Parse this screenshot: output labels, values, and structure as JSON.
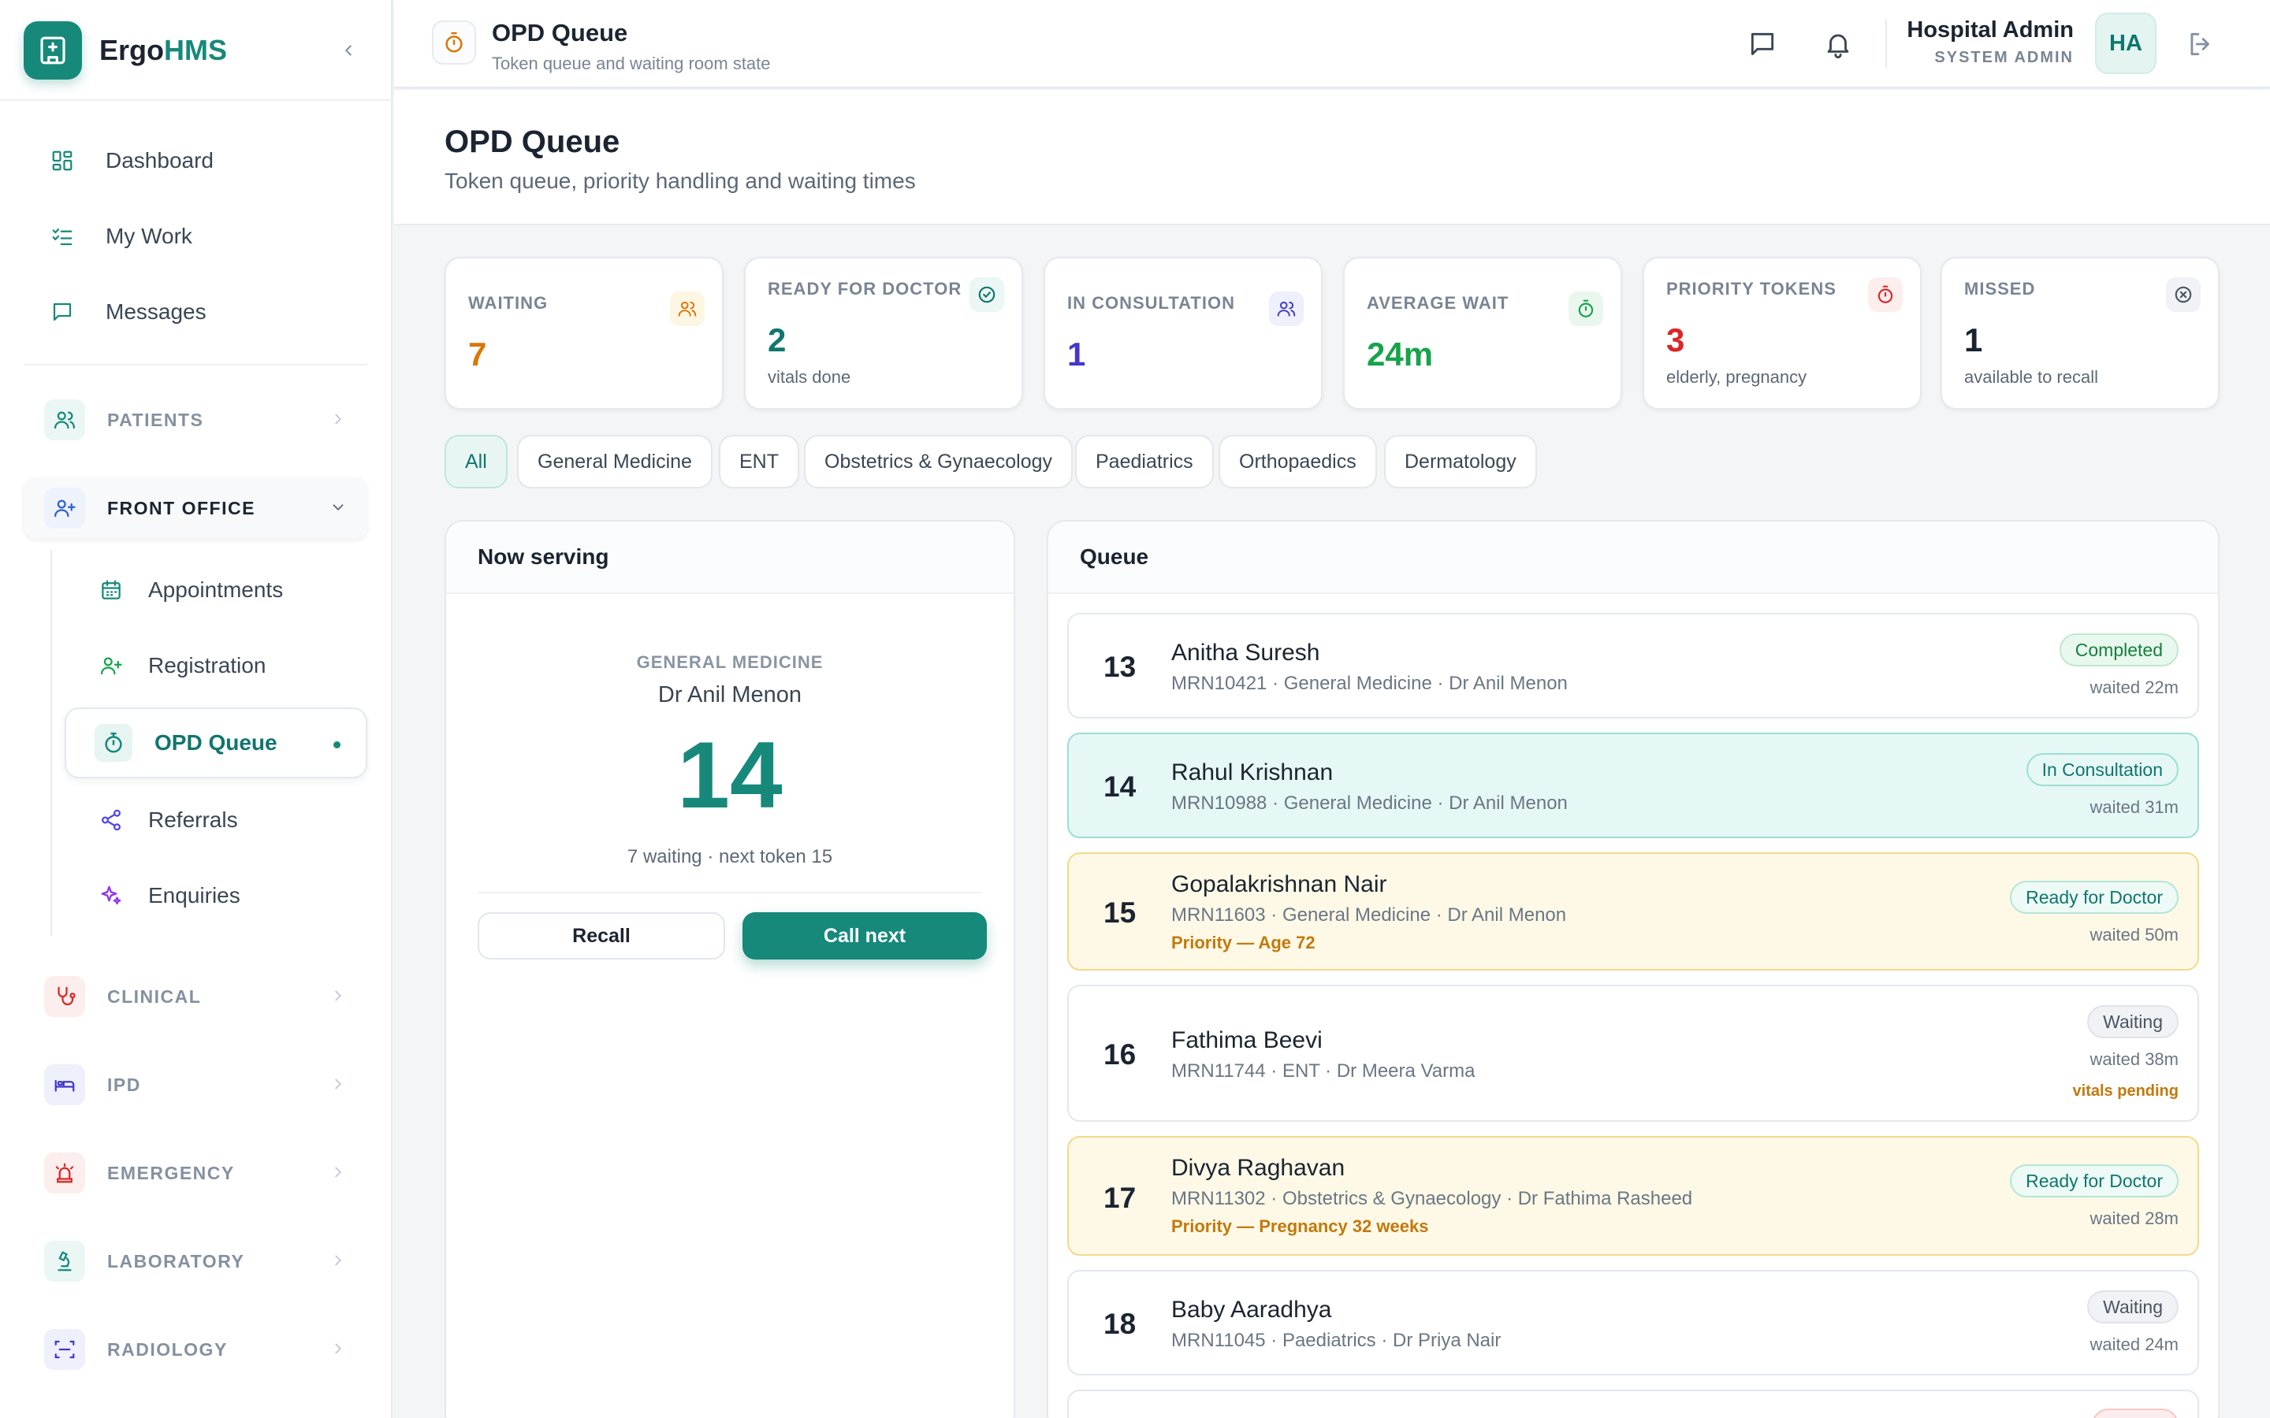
{
  "app": {
    "brand_prefix": "Ergo",
    "brand_suffix": "HMS",
    "accent_color": "#16897a"
  },
  "sidebar": {
    "top_items": [
      {
        "label": "Dashboard",
        "icon": "dashboard-grid-icon"
      },
      {
        "label": "My Work",
        "icon": "checklist-icon"
      },
      {
        "label": "Messages",
        "icon": "message-icon"
      }
    ],
    "groups": [
      {
        "label": "PATIENTS",
        "icon": "users-icon",
        "open": false
      },
      {
        "label": "FRONT OFFICE",
        "icon": "user-plus-icon",
        "open": true
      },
      {
        "label": "CLINICAL",
        "icon": "stethoscope-icon",
        "open": false
      },
      {
        "label": "IPD",
        "icon": "bed-icon",
        "open": false
      },
      {
        "label": "EMERGENCY",
        "icon": "siren-icon",
        "open": false
      },
      {
        "label": "LABORATORY",
        "icon": "microscope-icon",
        "open": false
      },
      {
        "label": "RADIOLOGY",
        "icon": "scan-icon",
        "open": false
      }
    ],
    "front_office_items": [
      {
        "label": "Appointments",
        "icon": "calendar-icon"
      },
      {
        "label": "Registration",
        "icon": "user-plus-icon"
      },
      {
        "label": "OPD Queue",
        "icon": "timer-icon",
        "active": true
      },
      {
        "label": "Referrals",
        "icon": "share-icon"
      },
      {
        "label": "Enquiries",
        "icon": "sparkles-icon"
      }
    ]
  },
  "topbar": {
    "title": "OPD Queue",
    "subtitle": "Token queue and waiting room state",
    "user_name": "Hospital Admin",
    "user_role": "SYSTEM ADMIN",
    "avatar_initials": "HA"
  },
  "page": {
    "title": "OPD Queue",
    "subtitle": "Token queue, priority handling and waiting times"
  },
  "stats": [
    {
      "label": "WAITING",
      "value": "7",
      "sub": "",
      "color": "#d97706",
      "icon": "users-icon"
    },
    {
      "label": "READY FOR DOCTOR",
      "value": "2",
      "sub": "vitals done",
      "color": "#0f766e",
      "icon": "check-circle-icon"
    },
    {
      "label": "IN CONSULTATION",
      "value": "1",
      "sub": "",
      "color": "#4338ca",
      "icon": "users-icon"
    },
    {
      "label": "AVERAGE WAIT",
      "value": "24m",
      "sub": "",
      "color": "#16a34a",
      "icon": "timer-icon"
    },
    {
      "label": "PRIORITY TOKENS",
      "value": "3",
      "sub": "elderly, pregnancy",
      "color": "#dc2626",
      "icon": "timer-icon"
    },
    {
      "label": "MISSED",
      "value": "1",
      "sub": "available to recall",
      "color": "#1b2430",
      "icon": "x-circle-icon"
    }
  ],
  "filters": {
    "selected": "All",
    "options": [
      "All",
      "General Medicine",
      "ENT",
      "Obstetrics & Gynaecology",
      "Paediatrics",
      "Orthopaedics",
      "Dermatology"
    ]
  },
  "now_serving": {
    "heading": "Now serving",
    "department": "GENERAL MEDICINE",
    "doctor": "Dr Anil Menon",
    "token": "14",
    "meta": "7 waiting · next token 15",
    "recall_label": "Recall",
    "call_next_label": "Call next"
  },
  "queue": {
    "heading": "Queue",
    "rows": [
      {
        "token": "13",
        "name": "Anitha Suresh",
        "meta": "MRN10421 · General Medicine · Dr Anil Menon",
        "priority": "",
        "status": "Completed",
        "wait": "waited 22m",
        "flag": ""
      },
      {
        "token": "14",
        "name": "Rahul Krishnan",
        "meta": "MRN10988 · General Medicine · Dr Anil Menon",
        "priority": "",
        "status": "In Consultation",
        "wait": "waited 31m",
        "flag": ""
      },
      {
        "token": "15",
        "name": "Gopalakrishnan Nair",
        "meta": "MRN11603 · General Medicine · Dr Anil Menon",
        "priority": "Priority — Age 72",
        "status": "Ready for Doctor",
        "wait": "waited 50m",
        "flag": ""
      },
      {
        "token": "16",
        "name": "Fathima Beevi",
        "meta": "MRN11744 · ENT · Dr Meera Varma",
        "priority": "",
        "status": "Waiting",
        "wait": "waited 38m",
        "flag": "vitals pending"
      },
      {
        "token": "17",
        "name": "Divya Raghavan",
        "meta": "MRN11302 · Obstetrics & Gynaecology · Dr Fathima Rasheed",
        "priority": "Priority — Pregnancy 32 weeks",
        "status": "Ready for Doctor",
        "wait": "waited 28m",
        "flag": ""
      },
      {
        "token": "18",
        "name": "Baby Aaradhya",
        "meta": "MRN11045 · Paediatrics · Dr Priya Nair",
        "priority": "",
        "status": "Waiting",
        "wait": "waited 24m",
        "flag": ""
      }
    ]
  }
}
